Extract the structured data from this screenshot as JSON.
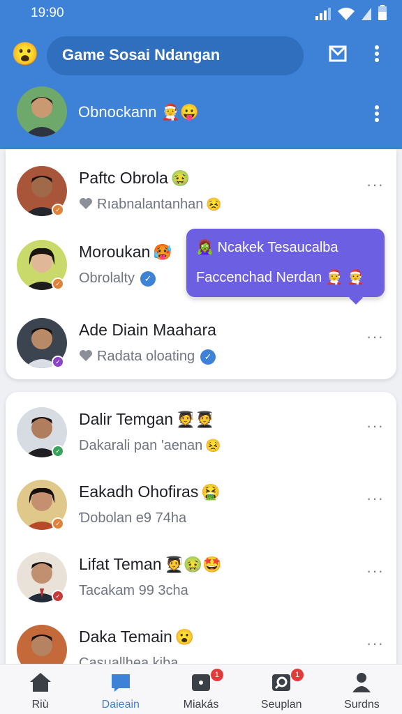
{
  "status": {
    "time": "19:90"
  },
  "header": {
    "search_title": "Game Sosai Ndangan",
    "me_name": "Obnockann",
    "me_emojis": "🧑‍🎄😛",
    "menu_emoji": "😮"
  },
  "popup": {
    "line1": "🧟‍♀️ Ncakek Tesaucalba",
    "line2": "Faccenchad Nerdan 🧑‍🎄 🧑‍🎄"
  },
  "friends_top": [
    {
      "name": "Paftc Obrola",
      "name_emoji": "🤢",
      "status": "Rıabnalantanhan",
      "status_emoji": "😣",
      "badge_color": "#e0823a",
      "sub_icon": "heart"
    },
    {
      "name": "Moroukan",
      "name_emoji": "🥵",
      "status": "Obrolalty",
      "status_emoji": "",
      "badge_color": "#e0823a",
      "sub_icon": "verified"
    },
    {
      "name": "Ade Diain Maahara",
      "name_emoji": "",
      "status": "Radata oloating",
      "status_emoji": "",
      "badge_color": "#8a44c8",
      "sub_icon": "heart-verified"
    }
  ],
  "friends_bottom": [
    {
      "name": "Dalir Temgan",
      "name_emoji": "🧑‍🎓🧑‍🎓",
      "status": "Dakarali pan 'aenan",
      "status_emoji": "😣",
      "badge_color": "#38a25a"
    },
    {
      "name": "Eakadh Ohofiras",
      "name_emoji": "🤮",
      "status": "Ɗobolan e9 74ha",
      "status_emoji": "",
      "badge_color": "#e0823a"
    },
    {
      "name": "Lifat Teman",
      "name_emoji": "🧑‍🎓🤢🤩",
      "status": "Tacakam 99 3cha",
      "status_emoji": "",
      "badge_color": "#c43b3b"
    },
    {
      "name": "Daka Temain",
      "name_emoji": "😮",
      "status": "Casuallhea kiba",
      "status_emoji": "",
      "badge_color": "#e0823a"
    }
  ],
  "nav": [
    {
      "label": "Riù",
      "icon": "home-icon",
      "badge": ""
    },
    {
      "label": "Daieain",
      "icon": "chat-icon",
      "badge": ""
    },
    {
      "label": "Miakás",
      "icon": "games-icon",
      "badge": "1"
    },
    {
      "label": "Seuplan",
      "icon": "search-icon",
      "badge": "1"
    },
    {
      "label": "Surdns",
      "icon": "profile-icon",
      "badge": ""
    }
  ],
  "colors": {
    "primary": "#3d82d6",
    "popup": "#6c5fe2",
    "badge_red": "#e23b3b"
  }
}
